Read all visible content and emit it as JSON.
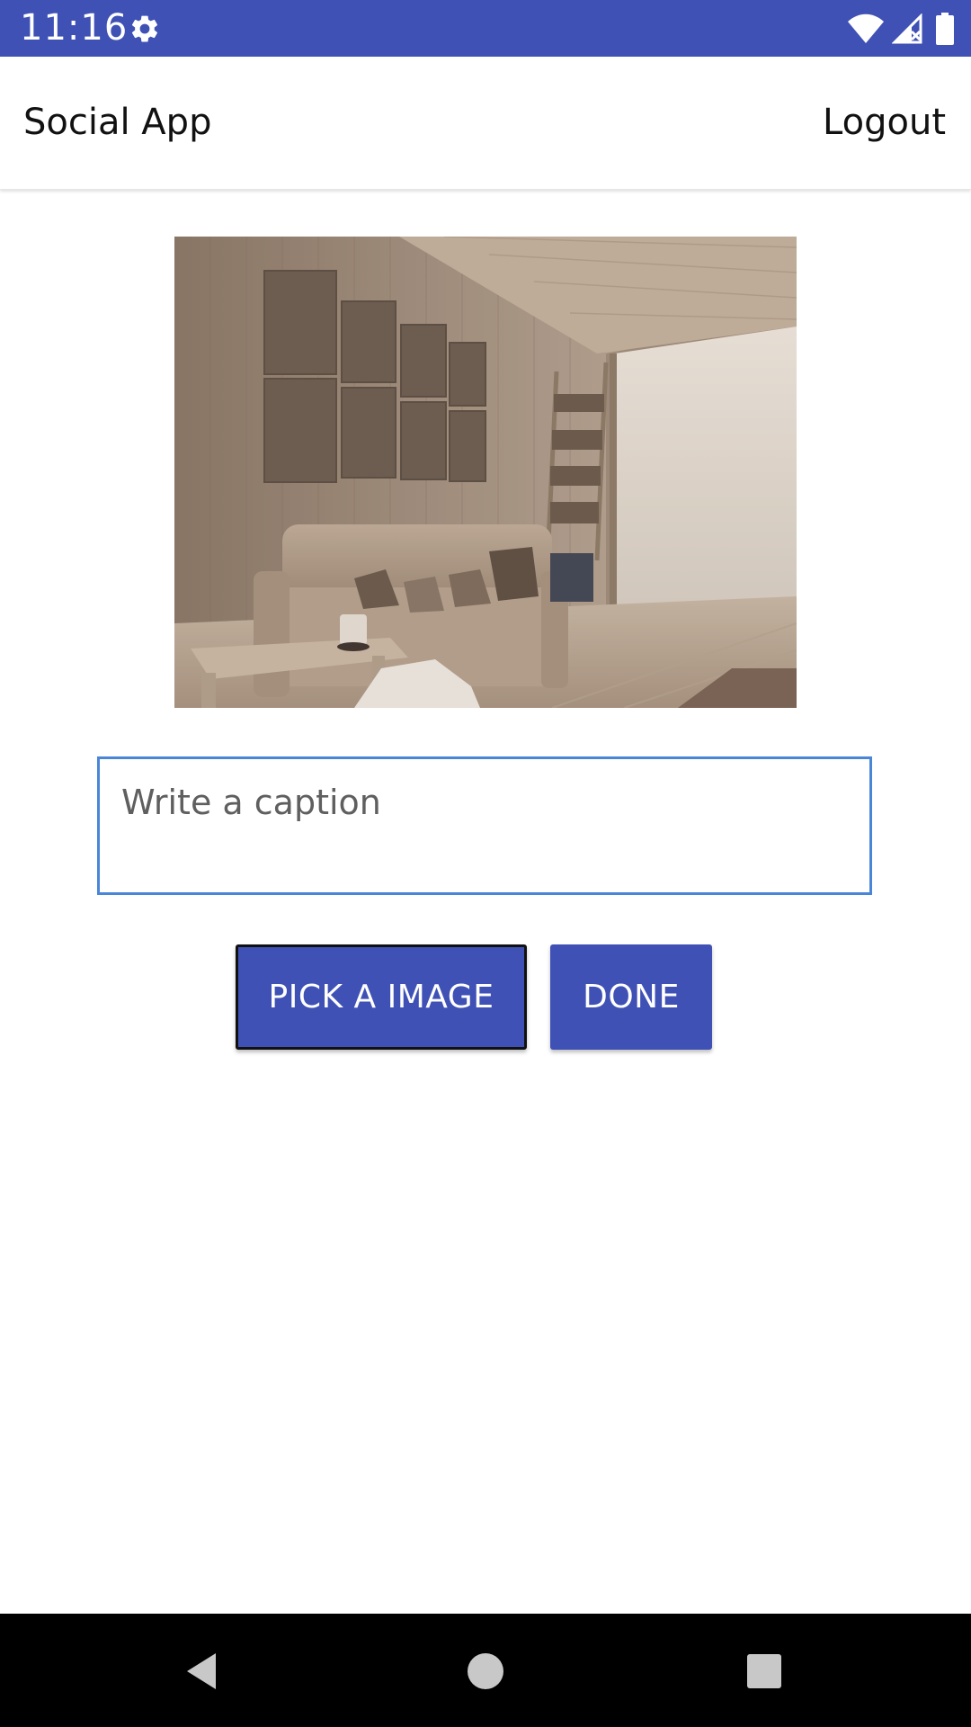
{
  "status_bar": {
    "time": "11:16",
    "background": "#3f51b5",
    "icons": [
      "gear-icon",
      "wifi-icon",
      "signal-icon",
      "battery-icon"
    ]
  },
  "app_bar": {
    "title": "Social App",
    "logout_label": "Logout"
  },
  "preview": {
    "description_icon": "selected-image"
  },
  "caption": {
    "value": "",
    "placeholder": "Write a caption"
  },
  "buttons": {
    "pick_label": "PICK A IMAGE",
    "done_label": "DONE"
  },
  "colors": {
    "primary": "#3f51b5",
    "focus_border": "#4a86d8"
  },
  "nav_bar": {
    "icons": [
      "back-icon",
      "home-icon",
      "recents-icon"
    ]
  }
}
